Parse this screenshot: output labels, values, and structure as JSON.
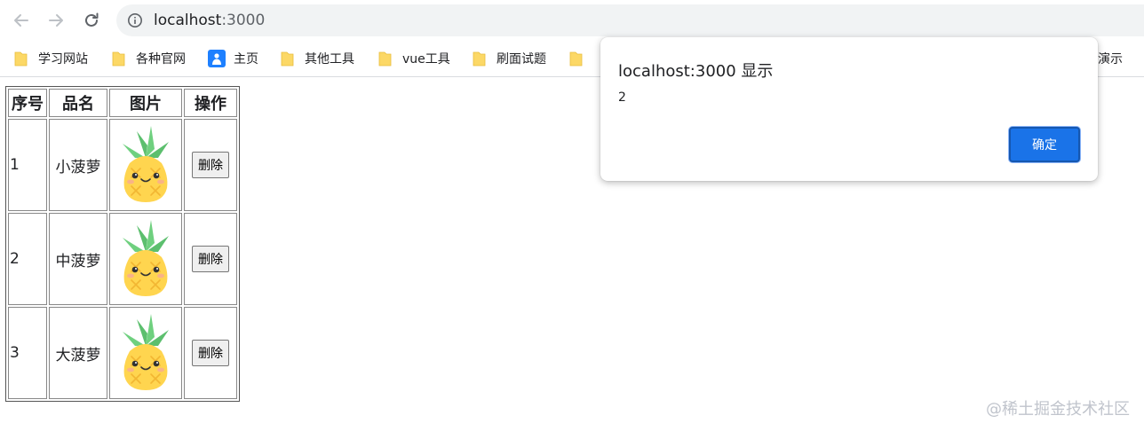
{
  "browser": {
    "url_host": "localhost",
    "url_port": ":3000",
    "bookmarks": [
      {
        "label": "学习网站",
        "icon": "folder-icon"
      },
      {
        "label": "各种官网",
        "icon": "folder-icon"
      },
      {
        "label": "主页",
        "icon": "profile-page-icon"
      },
      {
        "label": "其他工具",
        "icon": "folder-icon"
      },
      {
        "label": "vue工具",
        "icon": "folder-icon"
      },
      {
        "label": "刷面试题",
        "icon": "folder-icon"
      },
      {
        "label": "",
        "icon": "folder-icon"
      },
      {
        "label": "演示",
        "icon": ""
      }
    ]
  },
  "table": {
    "headers": [
      "序号",
      "品名",
      "图片",
      "操作"
    ],
    "rows": [
      {
        "no": "1",
        "name": "小菠萝",
        "image": "pineapple-image",
        "action": "删除"
      },
      {
        "no": "2",
        "name": "中菠萝",
        "image": "pineapple-image",
        "action": "删除"
      },
      {
        "no": "3",
        "name": "大菠萝",
        "image": "pineapple-image",
        "action": "删除"
      }
    ]
  },
  "dialog": {
    "title": "localhost:3000 显示",
    "message": "2",
    "ok_label": "确定"
  },
  "watermark": "@稀土掘金技术社区",
  "colors": {
    "accent": "#1a73e8",
    "folder": "#fcd866",
    "pineapple_body": "#ffd54f",
    "pineapple_leaves": "#5cbf6e"
  }
}
